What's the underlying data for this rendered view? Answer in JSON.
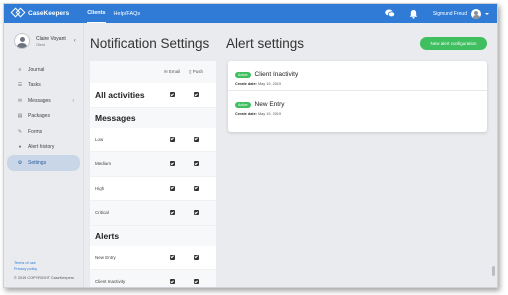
{
  "topbar": {
    "brand": "CaseKeepers",
    "nav": [
      "Clients",
      "Help/FAQs"
    ],
    "user_name": "Sigmund Freud",
    "icons": [
      "chat-icon",
      "bell-icon",
      "avatar",
      "chevron-down-icon"
    ]
  },
  "sidebar": {
    "profile_name": "Claire Voyant",
    "profile_role": "Client",
    "collapse": "‹",
    "items": [
      {
        "label": "Journal",
        "icon": "≡"
      },
      {
        "label": "Tasks",
        "icon": "☰"
      },
      {
        "label": "Messages",
        "icon": "✉"
      },
      {
        "label": "Packages",
        "icon": "▤"
      },
      {
        "label": "Forms",
        "icon": "✎"
      },
      {
        "label": "Alert history",
        "icon": "●"
      },
      {
        "label": "Settings",
        "icon": "⚙"
      }
    ],
    "messages_arrow": "‹",
    "footer": {
      "terms": "Terms of use",
      "privacy": "Privacy policy",
      "copyright": "© 2019 COPYRIGHT CaseKeepers"
    }
  },
  "notifications": {
    "title": "Notification Settings",
    "col_email": "Email",
    "col_push": "Push",
    "all_label": "All activities",
    "sections": [
      {
        "title": "Messages",
        "rows": [
          "Low",
          "Medium",
          "High",
          "Critical"
        ]
      },
      {
        "title": "Alerts",
        "rows": [
          "New Entry",
          "Client Inactivity"
        ]
      }
    ]
  },
  "alerts": {
    "title": "Alert settings",
    "new_button": "New alert configuration",
    "items": [
      {
        "badge": "Active",
        "name": "Client Inactivity",
        "date_label": "Create date:",
        "date": "May 19, 2019"
      },
      {
        "badge": "Active",
        "name": "New Entry",
        "date_label": "Create date:",
        "date": "May 19, 2019"
      }
    ]
  },
  "colors": {
    "topbar": "#2f7bd6",
    "accent_green": "#3fbf5f",
    "active_menu": "#c9d6e8"
  }
}
